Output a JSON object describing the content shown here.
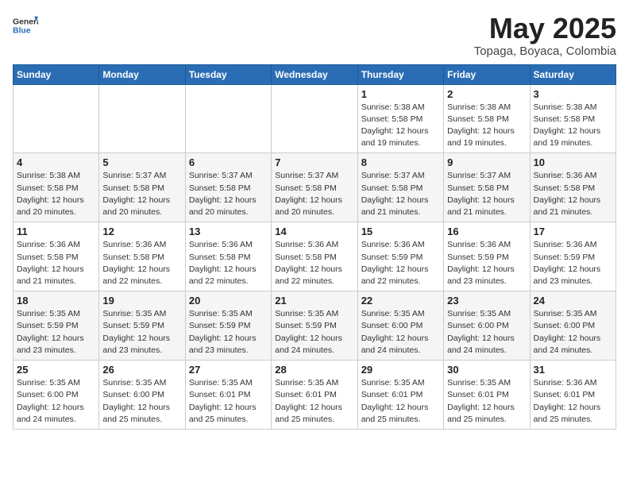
{
  "header": {
    "logo_general": "General",
    "logo_blue": "Blue",
    "month": "May 2025",
    "location": "Topaga, Boyaca, Colombia"
  },
  "weekdays": [
    "Sunday",
    "Monday",
    "Tuesday",
    "Wednesday",
    "Thursday",
    "Friday",
    "Saturday"
  ],
  "weeks": [
    [
      {
        "day": "",
        "info": ""
      },
      {
        "day": "",
        "info": ""
      },
      {
        "day": "",
        "info": ""
      },
      {
        "day": "",
        "info": ""
      },
      {
        "day": "1",
        "info": "Sunrise: 5:38 AM\nSunset: 5:58 PM\nDaylight: 12 hours\nand 19 minutes."
      },
      {
        "day": "2",
        "info": "Sunrise: 5:38 AM\nSunset: 5:58 PM\nDaylight: 12 hours\nand 19 minutes."
      },
      {
        "day": "3",
        "info": "Sunrise: 5:38 AM\nSunset: 5:58 PM\nDaylight: 12 hours\nand 19 minutes."
      }
    ],
    [
      {
        "day": "4",
        "info": "Sunrise: 5:38 AM\nSunset: 5:58 PM\nDaylight: 12 hours\nand 20 minutes."
      },
      {
        "day": "5",
        "info": "Sunrise: 5:37 AM\nSunset: 5:58 PM\nDaylight: 12 hours\nand 20 minutes."
      },
      {
        "day": "6",
        "info": "Sunrise: 5:37 AM\nSunset: 5:58 PM\nDaylight: 12 hours\nand 20 minutes."
      },
      {
        "day": "7",
        "info": "Sunrise: 5:37 AM\nSunset: 5:58 PM\nDaylight: 12 hours\nand 20 minutes."
      },
      {
        "day": "8",
        "info": "Sunrise: 5:37 AM\nSunset: 5:58 PM\nDaylight: 12 hours\nand 21 minutes."
      },
      {
        "day": "9",
        "info": "Sunrise: 5:37 AM\nSunset: 5:58 PM\nDaylight: 12 hours\nand 21 minutes."
      },
      {
        "day": "10",
        "info": "Sunrise: 5:36 AM\nSunset: 5:58 PM\nDaylight: 12 hours\nand 21 minutes."
      }
    ],
    [
      {
        "day": "11",
        "info": "Sunrise: 5:36 AM\nSunset: 5:58 PM\nDaylight: 12 hours\nand 21 minutes."
      },
      {
        "day": "12",
        "info": "Sunrise: 5:36 AM\nSunset: 5:58 PM\nDaylight: 12 hours\nand 22 minutes."
      },
      {
        "day": "13",
        "info": "Sunrise: 5:36 AM\nSunset: 5:58 PM\nDaylight: 12 hours\nand 22 minutes."
      },
      {
        "day": "14",
        "info": "Sunrise: 5:36 AM\nSunset: 5:58 PM\nDaylight: 12 hours\nand 22 minutes."
      },
      {
        "day": "15",
        "info": "Sunrise: 5:36 AM\nSunset: 5:59 PM\nDaylight: 12 hours\nand 22 minutes."
      },
      {
        "day": "16",
        "info": "Sunrise: 5:36 AM\nSunset: 5:59 PM\nDaylight: 12 hours\nand 23 minutes."
      },
      {
        "day": "17",
        "info": "Sunrise: 5:36 AM\nSunset: 5:59 PM\nDaylight: 12 hours\nand 23 minutes."
      }
    ],
    [
      {
        "day": "18",
        "info": "Sunrise: 5:35 AM\nSunset: 5:59 PM\nDaylight: 12 hours\nand 23 minutes."
      },
      {
        "day": "19",
        "info": "Sunrise: 5:35 AM\nSunset: 5:59 PM\nDaylight: 12 hours\nand 23 minutes."
      },
      {
        "day": "20",
        "info": "Sunrise: 5:35 AM\nSunset: 5:59 PM\nDaylight: 12 hours\nand 23 minutes."
      },
      {
        "day": "21",
        "info": "Sunrise: 5:35 AM\nSunset: 5:59 PM\nDaylight: 12 hours\nand 24 minutes."
      },
      {
        "day": "22",
        "info": "Sunrise: 5:35 AM\nSunset: 6:00 PM\nDaylight: 12 hours\nand 24 minutes."
      },
      {
        "day": "23",
        "info": "Sunrise: 5:35 AM\nSunset: 6:00 PM\nDaylight: 12 hours\nand 24 minutes."
      },
      {
        "day": "24",
        "info": "Sunrise: 5:35 AM\nSunset: 6:00 PM\nDaylight: 12 hours\nand 24 minutes."
      }
    ],
    [
      {
        "day": "25",
        "info": "Sunrise: 5:35 AM\nSunset: 6:00 PM\nDaylight: 12 hours\nand 24 minutes."
      },
      {
        "day": "26",
        "info": "Sunrise: 5:35 AM\nSunset: 6:00 PM\nDaylight: 12 hours\nand 25 minutes."
      },
      {
        "day": "27",
        "info": "Sunrise: 5:35 AM\nSunset: 6:01 PM\nDaylight: 12 hours\nand 25 minutes."
      },
      {
        "day": "28",
        "info": "Sunrise: 5:35 AM\nSunset: 6:01 PM\nDaylight: 12 hours\nand 25 minutes."
      },
      {
        "day": "29",
        "info": "Sunrise: 5:35 AM\nSunset: 6:01 PM\nDaylight: 12 hours\nand 25 minutes."
      },
      {
        "day": "30",
        "info": "Sunrise: 5:35 AM\nSunset: 6:01 PM\nDaylight: 12 hours\nand 25 minutes."
      },
      {
        "day": "31",
        "info": "Sunrise: 5:36 AM\nSunset: 6:01 PM\nDaylight: 12 hours\nand 25 minutes."
      }
    ]
  ]
}
